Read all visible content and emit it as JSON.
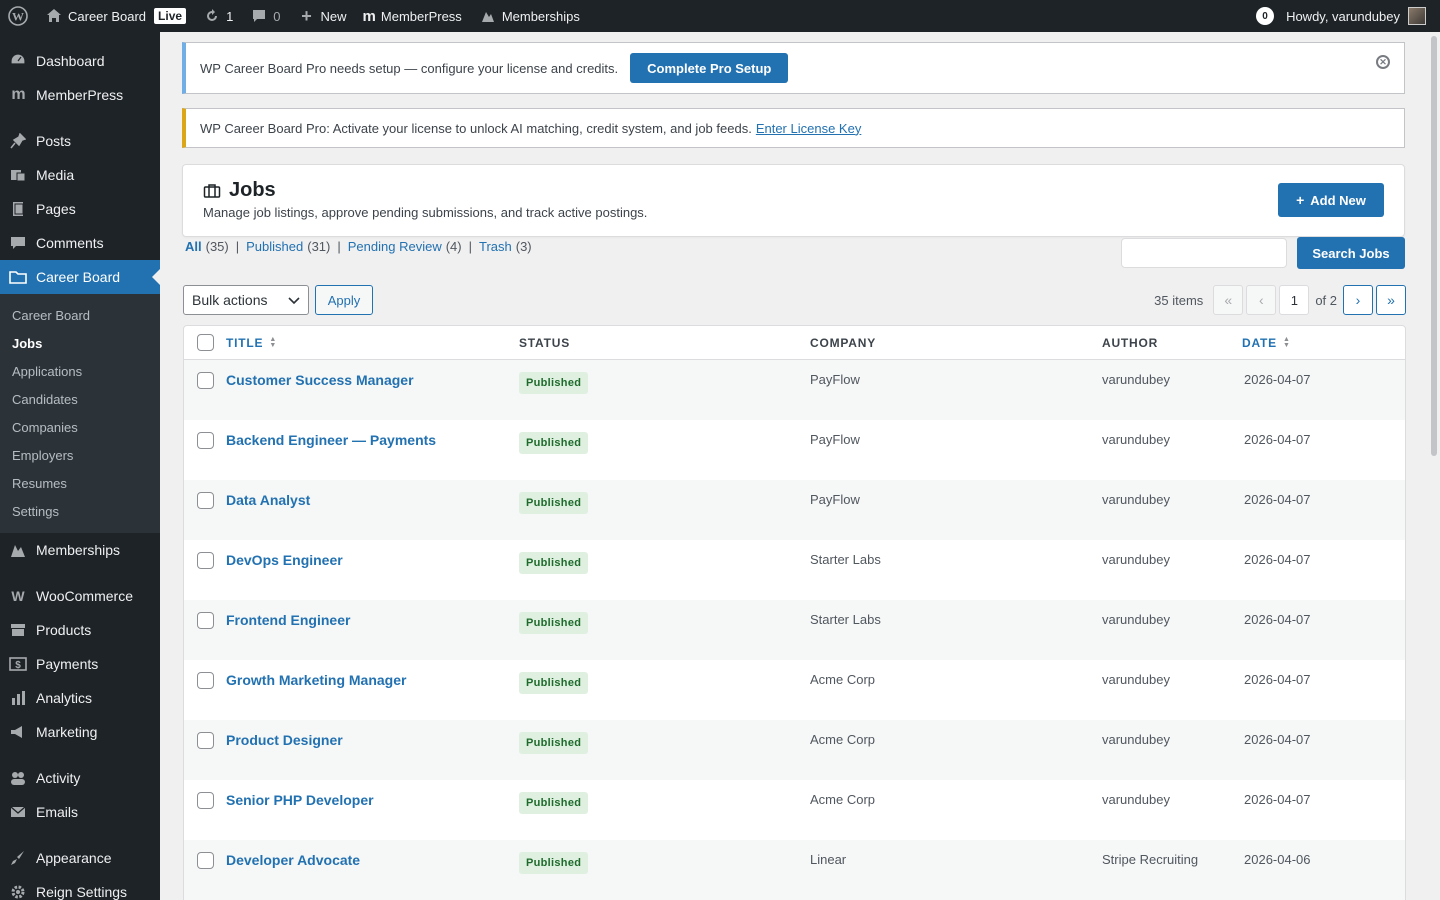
{
  "adminbar": {
    "site_name": "Career Board",
    "live_label": "Live",
    "updates_count": "1",
    "comments_count": "0",
    "new_label": "New",
    "memberpress_label": "MemberPress",
    "memberships_label": "Memberships",
    "notifications_count": "0",
    "howdy": "Howdy, varundubey"
  },
  "sidebar": {
    "items_top": [
      {
        "label": "Dashboard",
        "icon": "dashboard-icon"
      },
      {
        "label": "MemberPress",
        "icon": "memberpress-icon"
      }
    ],
    "items_content": [
      {
        "label": "Posts",
        "icon": "pin-icon"
      },
      {
        "label": "Media",
        "icon": "media-icon"
      },
      {
        "label": "Pages",
        "icon": "pages-icon"
      },
      {
        "label": "Comments",
        "icon": "comment-icon"
      }
    ],
    "current": {
      "label": "Career Board",
      "icon": "folder-icon"
    },
    "submenu": [
      "Career Board",
      "Jobs",
      "Applications",
      "Candidates",
      "Companies",
      "Employers",
      "Resumes",
      "Settings"
    ],
    "submenu_current": "Jobs",
    "items_bottom": [
      {
        "label": "Memberships",
        "icon": "memberships-icon"
      }
    ],
    "items_woo": [
      {
        "label": "WooCommerce",
        "icon": "woo-icon"
      },
      {
        "label": "Products",
        "icon": "products-icon"
      },
      {
        "label": "Payments",
        "icon": "payments-icon"
      },
      {
        "label": "Analytics",
        "icon": "analytics-icon"
      },
      {
        "label": "Marketing",
        "icon": "marketing-icon"
      }
    ],
    "items_bp": [
      {
        "label": "Activity",
        "icon": "activity-icon"
      },
      {
        "label": "Emails",
        "icon": "email-icon"
      }
    ],
    "items_last": [
      {
        "label": "Appearance",
        "icon": "appearance-icon"
      },
      {
        "label": "Reign Settings",
        "icon": "gear-icon"
      }
    ]
  },
  "notices": {
    "setup_text": "WP Career Board Pro needs setup — configure your license and credits.",
    "setup_button": "Complete Pro Setup",
    "license_text": "WP Career Board Pro: Activate your license to unlock AI matching, credit system, and job feeds.",
    "license_link": "Enter License Key"
  },
  "jobs_header": {
    "title": "Jobs",
    "subtitle": "Manage job listings, approve pending submissions, and track active postings.",
    "add_new": "Add New"
  },
  "filters": {
    "all": {
      "label": "All",
      "count": "(35)"
    },
    "published": {
      "label": "Published",
      "count": "(31)"
    },
    "pending": {
      "label": "Pending Review",
      "count": "(4)"
    },
    "trash": {
      "label": "Trash",
      "count": "(3)"
    }
  },
  "search": {
    "button": "Search Jobs",
    "value": ""
  },
  "tablenav": {
    "bulk_actions": "Bulk actions",
    "apply": "Apply",
    "items": "35 items",
    "first": "«",
    "prev": "‹",
    "current_page": "1",
    "of_pages": "of 2",
    "next": "›",
    "last": "»"
  },
  "table": {
    "columns": {
      "title": "TITLE",
      "status": "STATUS",
      "company": "COMPANY",
      "author": "AUTHOR",
      "date": "DATE"
    },
    "rows": [
      {
        "title": "Customer Success Manager",
        "status": "Published",
        "company": "PayFlow",
        "author": "varundubey",
        "date": "2026-04-07"
      },
      {
        "title": "Backend Engineer — Payments",
        "status": "Published",
        "company": "PayFlow",
        "author": "varundubey",
        "date": "2026-04-07"
      },
      {
        "title": "Data Analyst",
        "status": "Published",
        "company": "PayFlow",
        "author": "varundubey",
        "date": "2026-04-07"
      },
      {
        "title": "DevOps Engineer",
        "status": "Published",
        "company": "Starter Labs",
        "author": "varundubey",
        "date": "2026-04-07"
      },
      {
        "title": "Frontend Engineer",
        "status": "Published",
        "company": "Starter Labs",
        "author": "varundubey",
        "date": "2026-04-07"
      },
      {
        "title": "Growth Marketing Manager",
        "status": "Published",
        "company": "Acme Corp",
        "author": "varundubey",
        "date": "2026-04-07"
      },
      {
        "title": "Product Designer",
        "status": "Published",
        "company": "Acme Corp",
        "author": "varundubey",
        "date": "2026-04-07"
      },
      {
        "title": "Senior PHP Developer",
        "status": "Published",
        "company": "Acme Corp",
        "author": "varundubey",
        "date": "2026-04-07"
      },
      {
        "title": "Developer Advocate",
        "status": "Published",
        "company": "Linear",
        "author": "Stripe Recruiting",
        "date": "2026-04-06"
      }
    ]
  },
  "colors": {
    "accent": "#2271b1",
    "sidebar_bg": "#1d2327",
    "badge_bg": "#dff0e0",
    "badge_text": "#1e6b2c",
    "info_border": "#72aee6",
    "warning_border": "#dba617"
  }
}
